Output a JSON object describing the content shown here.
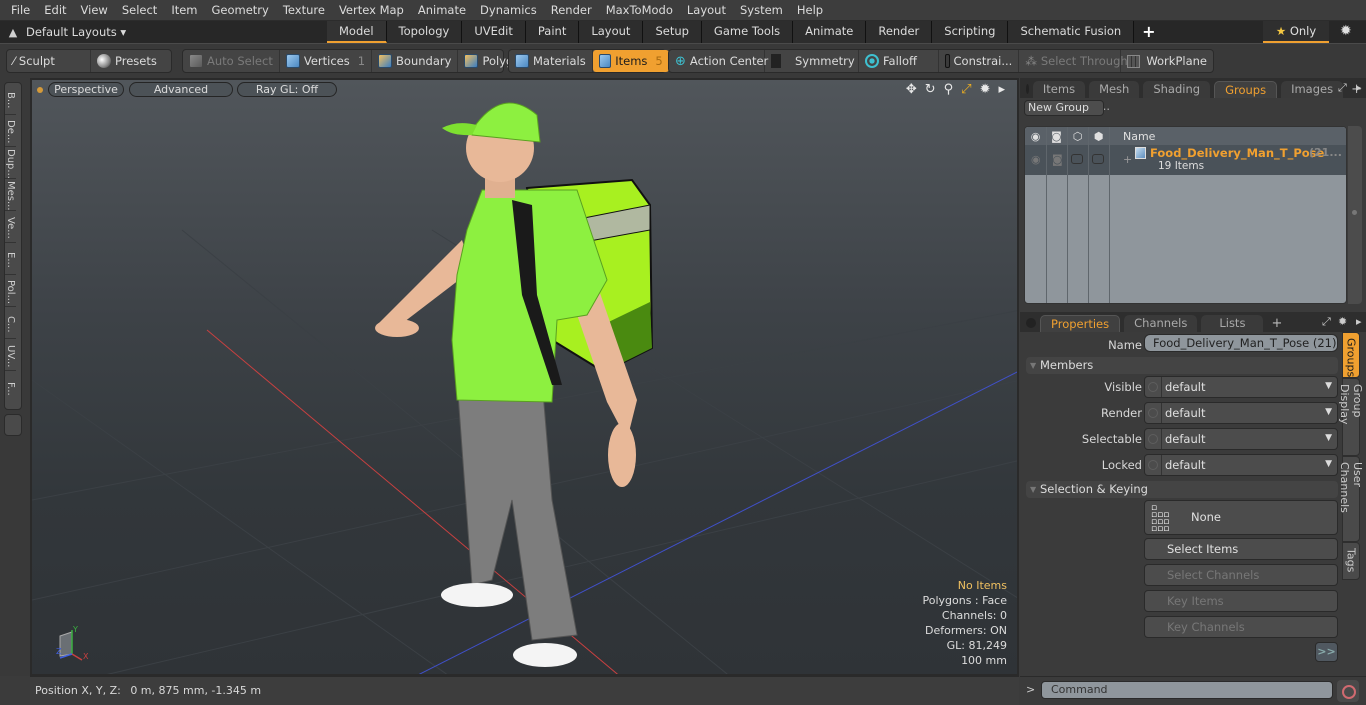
{
  "menu": [
    "File",
    "Edit",
    "View",
    "Select",
    "Item",
    "Geometry",
    "Texture",
    "Vertex Map",
    "Animate",
    "Dynamics",
    "Render",
    "MaxToModo",
    "Layout",
    "System",
    "Help"
  ],
  "layoutbar": {
    "layouts_label": "Default Layouts ▾",
    "tabs": [
      "Model",
      "Topology",
      "UVEdit",
      "Paint",
      "Layout",
      "Setup",
      "Game Tools",
      "Animate",
      "Render",
      "Scripting",
      "Schematic Fusion"
    ],
    "active_tab": "Model",
    "add_tab": "+",
    "only_label": "Only",
    "only_icon": "star-icon"
  },
  "toolbar": {
    "sculpt": "Sculpt",
    "presets": "Presets",
    "auto_select": "Auto Select",
    "vertices": "Vertices",
    "vertices_count": "1",
    "boundary": "Boundary",
    "polygons": "Polygons",
    "materials": "Materials",
    "items": "Items",
    "items_count": "5",
    "action_center": "Action Center",
    "symmetry": "Symmetry",
    "falloff": "Falloff",
    "constraints": "Constrai...",
    "select_through": "Select Through",
    "workplane": "WorkPlane"
  },
  "left_strip": [
    "B...",
    "De...",
    "Dup...",
    "Mes...",
    "Ve...",
    "E...",
    "Pol...",
    "C...",
    "UV...",
    "F..."
  ],
  "viewport": {
    "view_mode": "Perspective",
    "shading": "Advanced",
    "raygl": "Ray GL: Off",
    "icons": [
      "move-view-icon",
      "rotate-view-icon",
      "zoom-view-icon",
      "maximize-icon",
      "settings-icon",
      "more-icon"
    ],
    "stats": {
      "selection": "No Items",
      "polygons": "Polygons : Face",
      "channels": "Channels: 0",
      "deformers": "Deformers: ON",
      "gl": "GL: 81,249",
      "scale": "100 mm"
    },
    "axis_labels": {
      "x": "X",
      "y": "Y",
      "z": "Z"
    },
    "colors": {
      "shirt": "#8df040",
      "bag": "#a8f020",
      "pants": "#777777",
      "skin": "#e8b898",
      "x_axis": "#c84040",
      "z_axis": "#4050c8"
    }
  },
  "status": {
    "position_label": "Position X, Y, Z:",
    "position_value": "0 m, 875 mm, -1.345 m"
  },
  "groups_panel": {
    "tabs": [
      "Items",
      "Mesh ...",
      "Shading",
      "Groups",
      "Images"
    ],
    "active_tab": "Groups",
    "new_group": "New Group",
    "columns": {
      "name": "Name"
    },
    "groups": [
      {
        "name": "Food_Delivery_Man_T_Pose",
        "count_suffix": "(21...",
        "subtitle": "19 Items"
      }
    ]
  },
  "properties_panel": {
    "tabs": [
      "Properties",
      "Channels",
      "Lists"
    ],
    "active_tab": "Properties",
    "name_label": "Name",
    "name_value": "Food_Delivery_Man_T_Pose (21)",
    "members_section": "Members",
    "members": [
      {
        "label": "Visible",
        "value": "default"
      },
      {
        "label": "Render",
        "value": "default"
      },
      {
        "label": "Selectable",
        "value": "default"
      },
      {
        "label": "Locked",
        "value": "default"
      }
    ],
    "selection_section": "Selection & Keying",
    "none_button": "None",
    "buttons": [
      {
        "label": "Select Items",
        "enabled": true
      },
      {
        "label": "Select Channels",
        "enabled": false
      },
      {
        "label": "Key Items",
        "enabled": false
      },
      {
        "label": "Key Channels",
        "enabled": false
      }
    ],
    "more": ">>",
    "side_tabs": [
      "Groups",
      "Group Display",
      "User Channels",
      "Tags"
    ],
    "active_side_tab": "Groups"
  },
  "command": {
    "prompt": ">",
    "placeholder": "Command"
  },
  "accent_color": "#f0a030"
}
